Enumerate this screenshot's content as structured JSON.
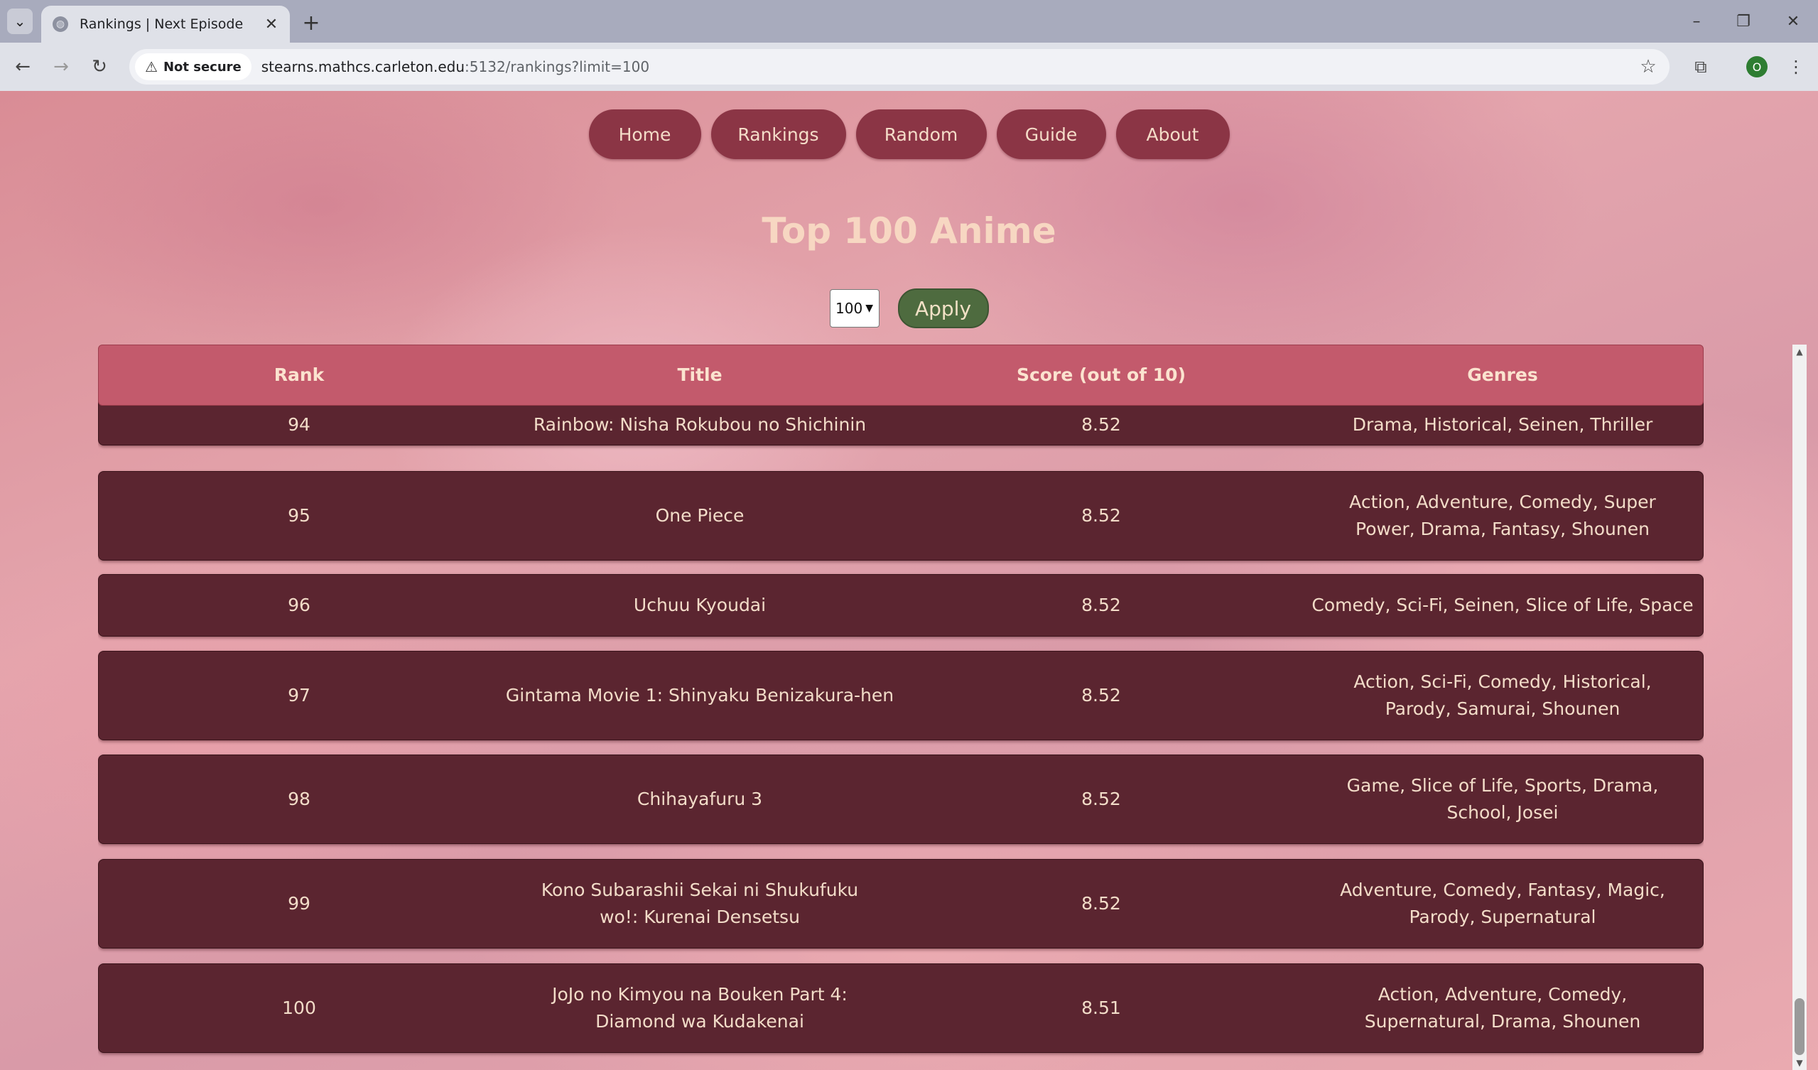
{
  "browser": {
    "tab_title": "Rankings | Next Episode",
    "security_label": "Not secure",
    "url_host": "stearns.mathcs.carleton.edu",
    "url_rest": ":5132/rankings?limit=100",
    "profile_initial": "O"
  },
  "nav": {
    "items": [
      "Home",
      "Rankings",
      "Random",
      "Guide",
      "About"
    ]
  },
  "page": {
    "heading": "Top 100 Anime",
    "limit_value": "100",
    "apply_label": "Apply"
  },
  "table": {
    "columns": [
      "Rank",
      "Title",
      "Score (out of 10)",
      "Genres"
    ],
    "rows": [
      {
        "rank": "94",
        "title": "Rainbow: Nisha Rokubou no Shichinin",
        "score": "8.52",
        "genres": "Drama, Historical, Seinen, Thriller"
      },
      {
        "rank": "95",
        "title": "One Piece",
        "score": "8.52",
        "genres": "Action, Adventure, Comedy, Super Power, Drama, Fantasy, Shounen"
      },
      {
        "rank": "96",
        "title": "Uchuu Kyoudai",
        "score": "8.52",
        "genres": "Comedy, Sci-Fi, Seinen, Slice of Life, Space"
      },
      {
        "rank": "97",
        "title": "Gintama Movie 1: Shinyaku Benizakura-hen",
        "score": "8.52",
        "genres": "Action, Sci-Fi, Comedy, Historical, Parody, Samurai, Shounen"
      },
      {
        "rank": "98",
        "title": "Chihayafuru 3",
        "score": "8.52",
        "genres": "Game, Slice of Life, Sports, Drama, School, Josei"
      },
      {
        "rank": "99",
        "title": "Kono Subarashii Sekai ni Shukufuku wo!: Kurenai Densetsu",
        "score": "8.52",
        "genres": "Adventure, Comedy, Fantasy, Magic, Parody, Supernatural"
      },
      {
        "rank": "100",
        "title": "JoJo no Kimyou na Bouken Part 4: Diamond wa Kudakenai",
        "score": "8.51",
        "genres": "Action, Adventure, Comedy, Supernatural, Drama, Shounen"
      }
    ]
  }
}
